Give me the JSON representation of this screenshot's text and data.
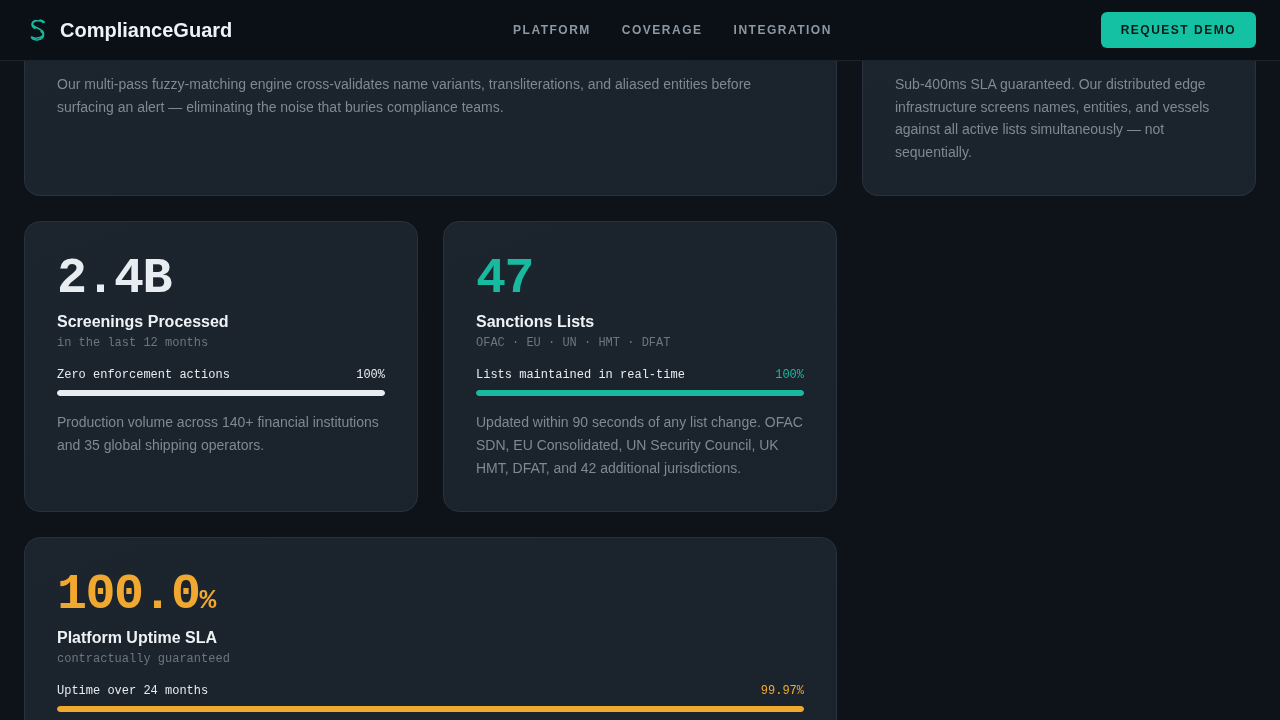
{
  "header": {
    "brand": "ComplianceGuard",
    "nav": [
      "PLATFORM",
      "COVERAGE",
      "INTEGRATION"
    ],
    "cta": "REQUEST DEMO"
  },
  "feature_cards": [
    {
      "body": "Our multi-pass fuzzy-matching engine cross-validates name variants, transliterations, and aliased entities before surfacing an alert — eliminating the noise that buries compliance teams."
    },
    {
      "body": "Sub-400ms SLA guaranteed. Our distributed edge infrastructure screens names, entities, and vessels against all active lists simultaneously — not sequentially."
    }
  ],
  "stat_cards": [
    {
      "value": "2.4B",
      "color": "#e8edf1",
      "title": "Screenings Processed",
      "subtitle": "in the last 12 months",
      "meter": {
        "label": "Zero enforcement actions",
        "reading": "100%",
        "level": 1
      },
      "body": "Production volume across 140+ financial institutions and 35 global shipping operators."
    },
    {
      "value": "47",
      "color": "#19b9a0",
      "title": "Sanctions Lists",
      "subtitle": "OFAC · EU · UN · HMT · DFAT",
      "meter": {
        "label": "Lists maintained in real-time",
        "reading": "100%",
        "level": 1
      },
      "body": "Updated within 90 seconds of any list change. OFAC SDN, EU Consolidated, UN Security Council, UK HMT, DFAT, and 42 additional jurisdictions."
    },
    {
      "value": "100.0",
      "unit": "%",
      "color": "#f0a830",
      "title": "Platform Uptime SLA",
      "subtitle": "contractually guaranteed",
      "meter": {
        "label": "Uptime over 24 months",
        "reading": "99.97%",
        "level": 0.9997
      }
    }
  ]
}
